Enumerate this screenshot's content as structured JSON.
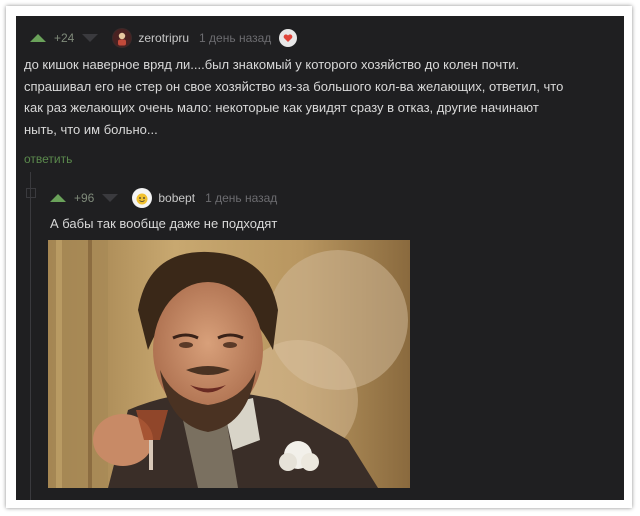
{
  "comment": {
    "score": "+24",
    "username": "zerotripru",
    "time": "1 день назад",
    "lines": [
      "до кишок наверное вряд ли....был знакомый у которого хозяйство до колен почти.",
      "спрашивал его не стер он свое хозяйство из-за большого кол-ва желающих, ответил, что",
      "как раз желающих очень мало: некоторые как увидят сразу в отказ, другие начинают",
      "ныть, что им больно..."
    ],
    "reply_label": "ответить",
    "avatar_icon": "avatar-figure-icon",
    "badge_icon": "heart-badge-icon"
  },
  "reply": {
    "score": "+96",
    "username": "bobept",
    "time": "1 день назад",
    "text": "А бабы так вообще даже не подходят",
    "avatar_icon": "smiley-avatar-icon",
    "image": "meme-photo"
  },
  "colors": {
    "background": "#1f1f21",
    "upvote": "#6aa25a",
    "downvote": "#3a3a3e",
    "reply_link": "#5b8a4d",
    "text": "#d8d8d8"
  }
}
